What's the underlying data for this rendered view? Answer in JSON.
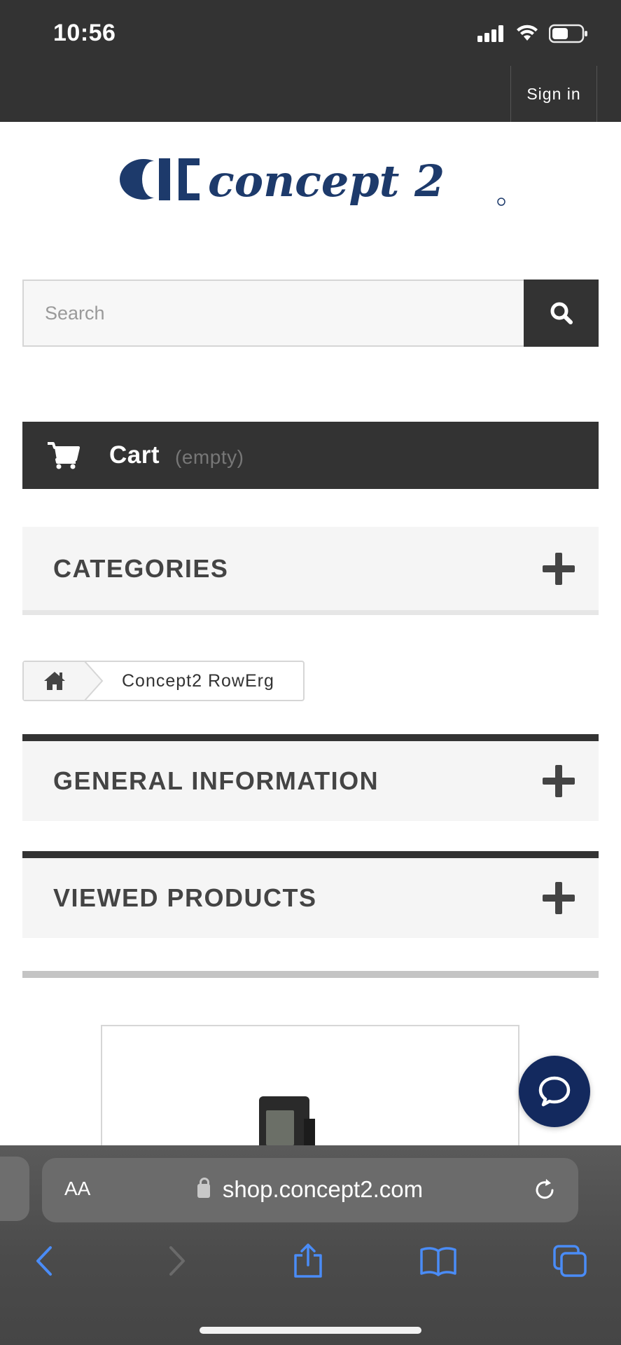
{
  "status_bar": {
    "time": "10:56"
  },
  "header": {
    "sign_in_label": "Sign in"
  },
  "brand": {
    "logo_text": "concept 2",
    "logo_color": "#1d3a6b"
  },
  "search": {
    "placeholder": "Search",
    "value": ""
  },
  "cart": {
    "label": "Cart",
    "status": "(empty)"
  },
  "accordions": {
    "categories": "CATEGORIES",
    "general_information": "GENERAL INFORMATION",
    "viewed_products": "VIEWED PRODUCTS"
  },
  "breadcrumb": {
    "current": "Concept2 RowErg"
  },
  "chat": {
    "color": "#13295e"
  },
  "browser": {
    "text_size_label": "AA",
    "url": "shop.concept2.com"
  },
  "colors": {
    "header_bg": "#333333",
    "accent_dark": "#333333",
    "browser_accent": "#4a8cf7"
  }
}
